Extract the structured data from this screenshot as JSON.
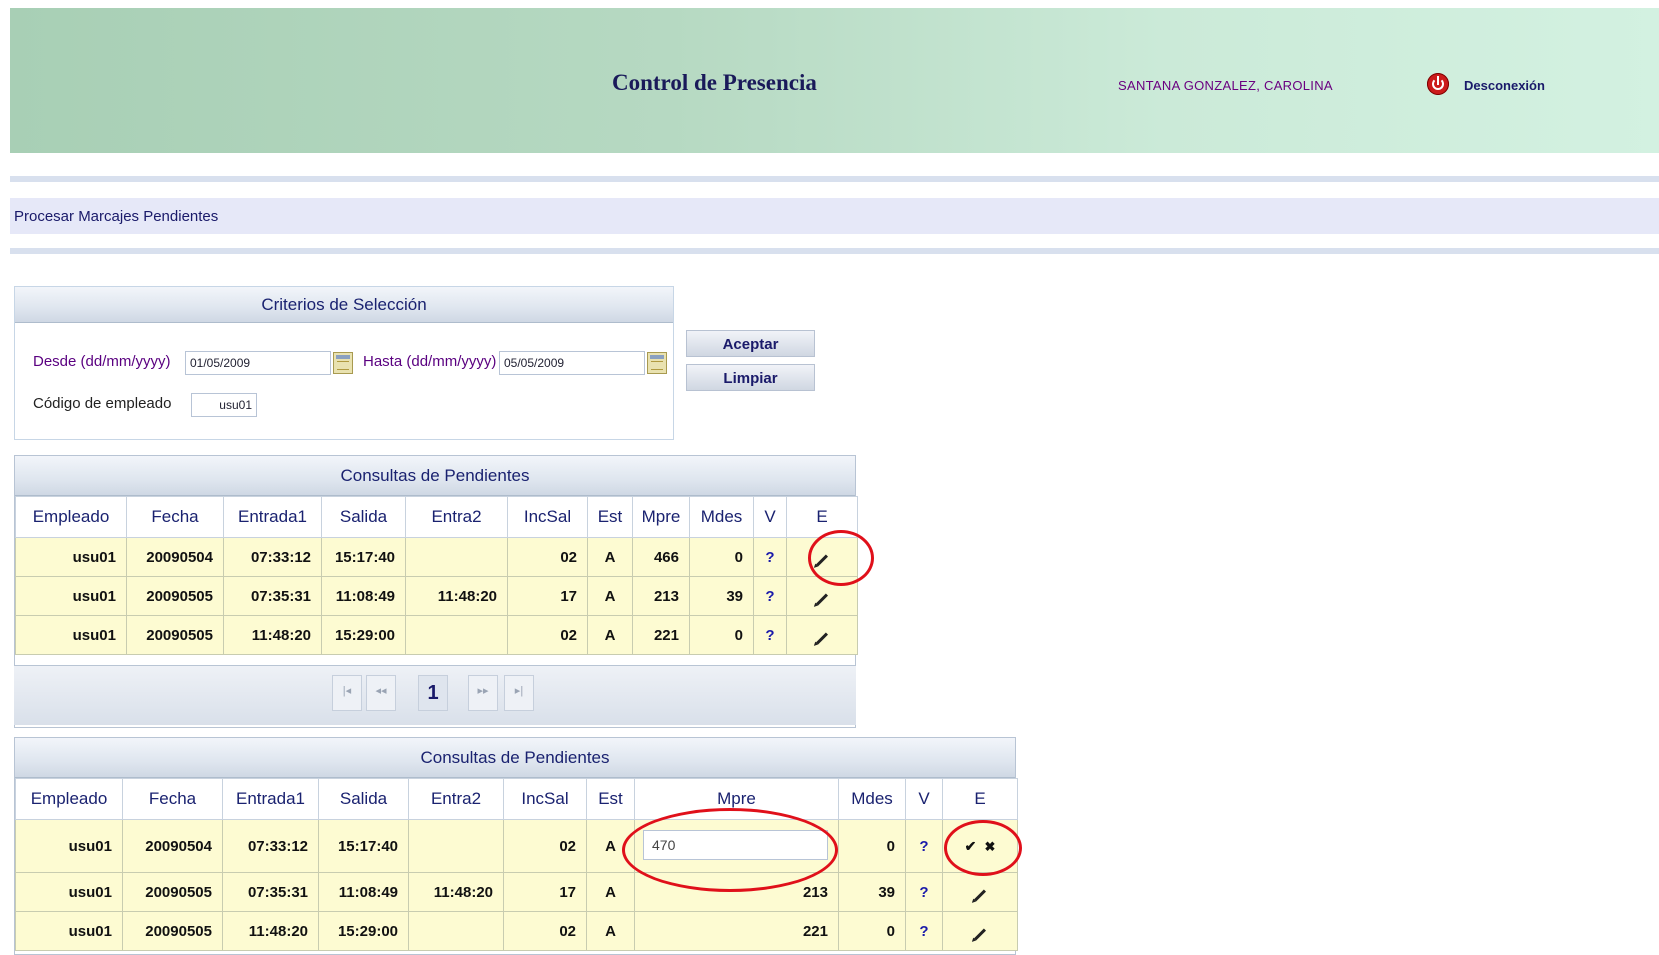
{
  "header": {
    "title": "Control de Presencia",
    "user": "SANTANA GONZALEZ, CAROLINA",
    "logout": "Desconexión",
    "logout_icon": "power-icon"
  },
  "breadcrumb": "Procesar Marcajes Pendientes",
  "criteria": {
    "title": "Criterios de Selección",
    "desde_label": "Desde (dd/mm/yyyy)",
    "desde_value": "01/05/2009",
    "hasta_label": "Hasta (dd/mm/yyyy)",
    "hasta_value": "05/05/2009",
    "codigo_label": "Código de empleado",
    "codigo_value": "usu01",
    "aceptar": "Aceptar",
    "limpiar": "Limpiar"
  },
  "table1": {
    "title": "Consultas de Pendientes",
    "columns": [
      "Empleado",
      "Fecha",
      "Entrada1",
      "Salida",
      "Entra2",
      "IncSal",
      "Est",
      "Mpre",
      "Mdes",
      "V",
      "E"
    ],
    "rows": [
      [
        "usu01",
        "20090504",
        "07:33:12",
        "15:17:40",
        "",
        "02",
        "A",
        "466",
        "0",
        "?",
        ""
      ],
      [
        "usu01",
        "20090505",
        "07:35:31",
        "11:08:49",
        "11:48:20",
        "17",
        "A",
        "213",
        "39",
        "?",
        ""
      ],
      [
        "usu01",
        "20090505",
        "11:48:20",
        "15:29:00",
        "",
        "02",
        "A",
        "221",
        "0",
        "?",
        ""
      ]
    ],
    "pager": {
      "first": "|◂",
      "prev": "◂◂",
      "current": "1",
      "next": "▸▸",
      "last": "▸|"
    }
  },
  "table2": {
    "title": "Consultas de Pendientes",
    "columns": [
      "Empleado",
      "Fecha",
      "Entrada1",
      "Salida",
      "Entra2",
      "IncSal",
      "Est",
      "Mpre",
      "Mdes",
      "V",
      "E"
    ],
    "rows": [
      [
        "usu01",
        "20090504",
        "07:33:12",
        "15:17:40",
        "",
        "02",
        "A",
        "470",
        "0",
        "?",
        ""
      ],
      [
        "usu01",
        "20090505",
        "07:35:31",
        "11:08:49",
        "11:48:20",
        "17",
        "A",
        "213",
        "39",
        "?",
        ""
      ],
      [
        "usu01",
        "20090505",
        "11:48:20",
        "15:29:00",
        "",
        "02",
        "A",
        "221",
        "0",
        "?",
        ""
      ]
    ],
    "confirm": "✔",
    "cancel": "✖"
  },
  "colors": {
    "header_bg": "#b6d9c2",
    "row_bg": "#fdfbd2",
    "highlight": "#e0101a"
  }
}
